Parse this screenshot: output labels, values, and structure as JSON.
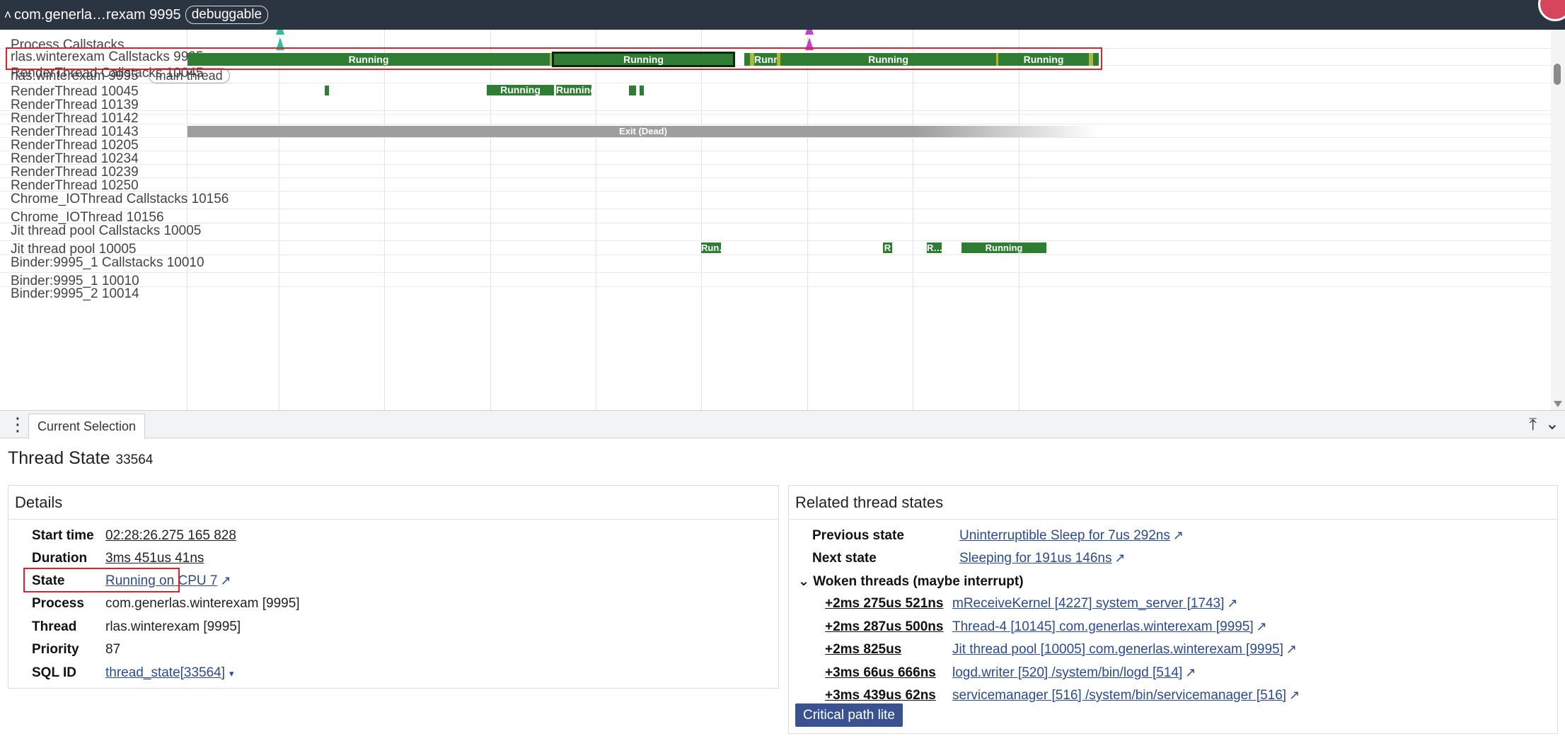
{
  "header": {
    "process_title": "com.generla…rexam 9995",
    "badge": "debuggable"
  },
  "tracks": [
    {
      "label": "Process Callstacks",
      "pill": ""
    },
    {
      "label": "rlas.winterexam Callstacks 9995",
      "pill": ""
    },
    {
      "label": "rlas.winterexam 9995",
      "pill": "main thread"
    },
    {
      "label": "RenderThread Callstacks 10045",
      "pill": ""
    },
    {
      "label": "RenderThread 10045",
      "pill": ""
    },
    {
      "label": "RenderThread 10139",
      "pill": ""
    },
    {
      "label": "RenderThread 10142",
      "pill": ""
    },
    {
      "label": "RenderThread 10143",
      "pill": ""
    },
    {
      "label": "RenderThread 10205",
      "pill": ""
    },
    {
      "label": "RenderThread 10234",
      "pill": ""
    },
    {
      "label": "RenderThread 10239",
      "pill": ""
    },
    {
      "label": "RenderThread 10250",
      "pill": ""
    },
    {
      "label": "Chrome_IOThread Callstacks 10156",
      "pill": ""
    },
    {
      "label": "Chrome_IOThread 10156",
      "pill": ""
    },
    {
      "label": "Jit thread pool Callstacks 10005",
      "pill": ""
    },
    {
      "label": "Jit thread pool 10005",
      "pill": ""
    },
    {
      "label": "Binder:9995_1 Callstacks 10010",
      "pill": ""
    },
    {
      "label": "Binder:9995_1 10010",
      "pill": ""
    },
    {
      "label": "Binder:9995_2 10014",
      "pill": ""
    }
  ],
  "slices": {
    "main_running": [
      "Running",
      "Running",
      "Runn…",
      "Running",
      "Running"
    ],
    "render_running": [
      "Running",
      "Running"
    ],
    "exit_dead": "Exit (Dead)",
    "jit": [
      "Run…",
      "R",
      "R…",
      "Running"
    ]
  },
  "tabs": {
    "current": "Current Selection"
  },
  "details": {
    "heading": "Thread State",
    "heading_id": "33564",
    "card_title": "Details",
    "rows": {
      "start_time": {
        "key": "Start time",
        "value": "02:28:26.275 165 828"
      },
      "duration": {
        "key": "Duration",
        "value": "3ms 451us 41ns"
      },
      "state": {
        "key": "State",
        "value": "Running on CPU 7"
      },
      "process": {
        "key": "Process",
        "value": "com.generlas.winterexam [9995]"
      },
      "thread": {
        "key": "Thread",
        "value": "rlas.winterexam [9995]"
      },
      "priority": {
        "key": "Priority",
        "value": "87"
      },
      "sql_id": {
        "key": "SQL ID",
        "value": "thread_state[33564]"
      }
    }
  },
  "related": {
    "card_title": "Related thread states",
    "previous_state": {
      "key": "Previous state",
      "value": "Uninterruptible Sleep for 7us 292ns"
    },
    "next_state": {
      "key": "Next state",
      "value": "Sleeping for 191us 146ns"
    },
    "woken_header": "Woken threads (maybe interrupt)",
    "woken": [
      {
        "delta": "+2ms 275us 521ns",
        "thread": "mReceiveKernel [4227] system_server [1743]"
      },
      {
        "delta": "+2ms 287us 500ns",
        "thread": "Thread-4 [10145] com.generlas.winterexam [9995]"
      },
      {
        "delta": "+2ms 825us",
        "thread": "Jit thread pool [10005] com.generlas.winterexam [9995]"
      },
      {
        "delta": "+3ms 66us 666ns",
        "thread": "logd.writer [520] /system/bin/logd [514]"
      },
      {
        "delta": "+3ms 439us 62ns",
        "thread": "servicemanager [516] /system/bin/servicemanager [516]"
      }
    ],
    "critical_path_button": "Critical path lite"
  },
  "icons": {
    "external_link": "↗",
    "collapse_chevron": "˄",
    "expand_chevron": "⌄",
    "dropdown": "▾",
    "kebab": "⋮",
    "pin": "⤒",
    "minimize": "⌄"
  },
  "colors": {
    "running": "#2e7d32",
    "runnable": "#a8b93c",
    "dead": "#9e9e9e",
    "link": "#2c4a8e",
    "highlight": "#e0202a",
    "header_bg": "#2b3441"
  }
}
